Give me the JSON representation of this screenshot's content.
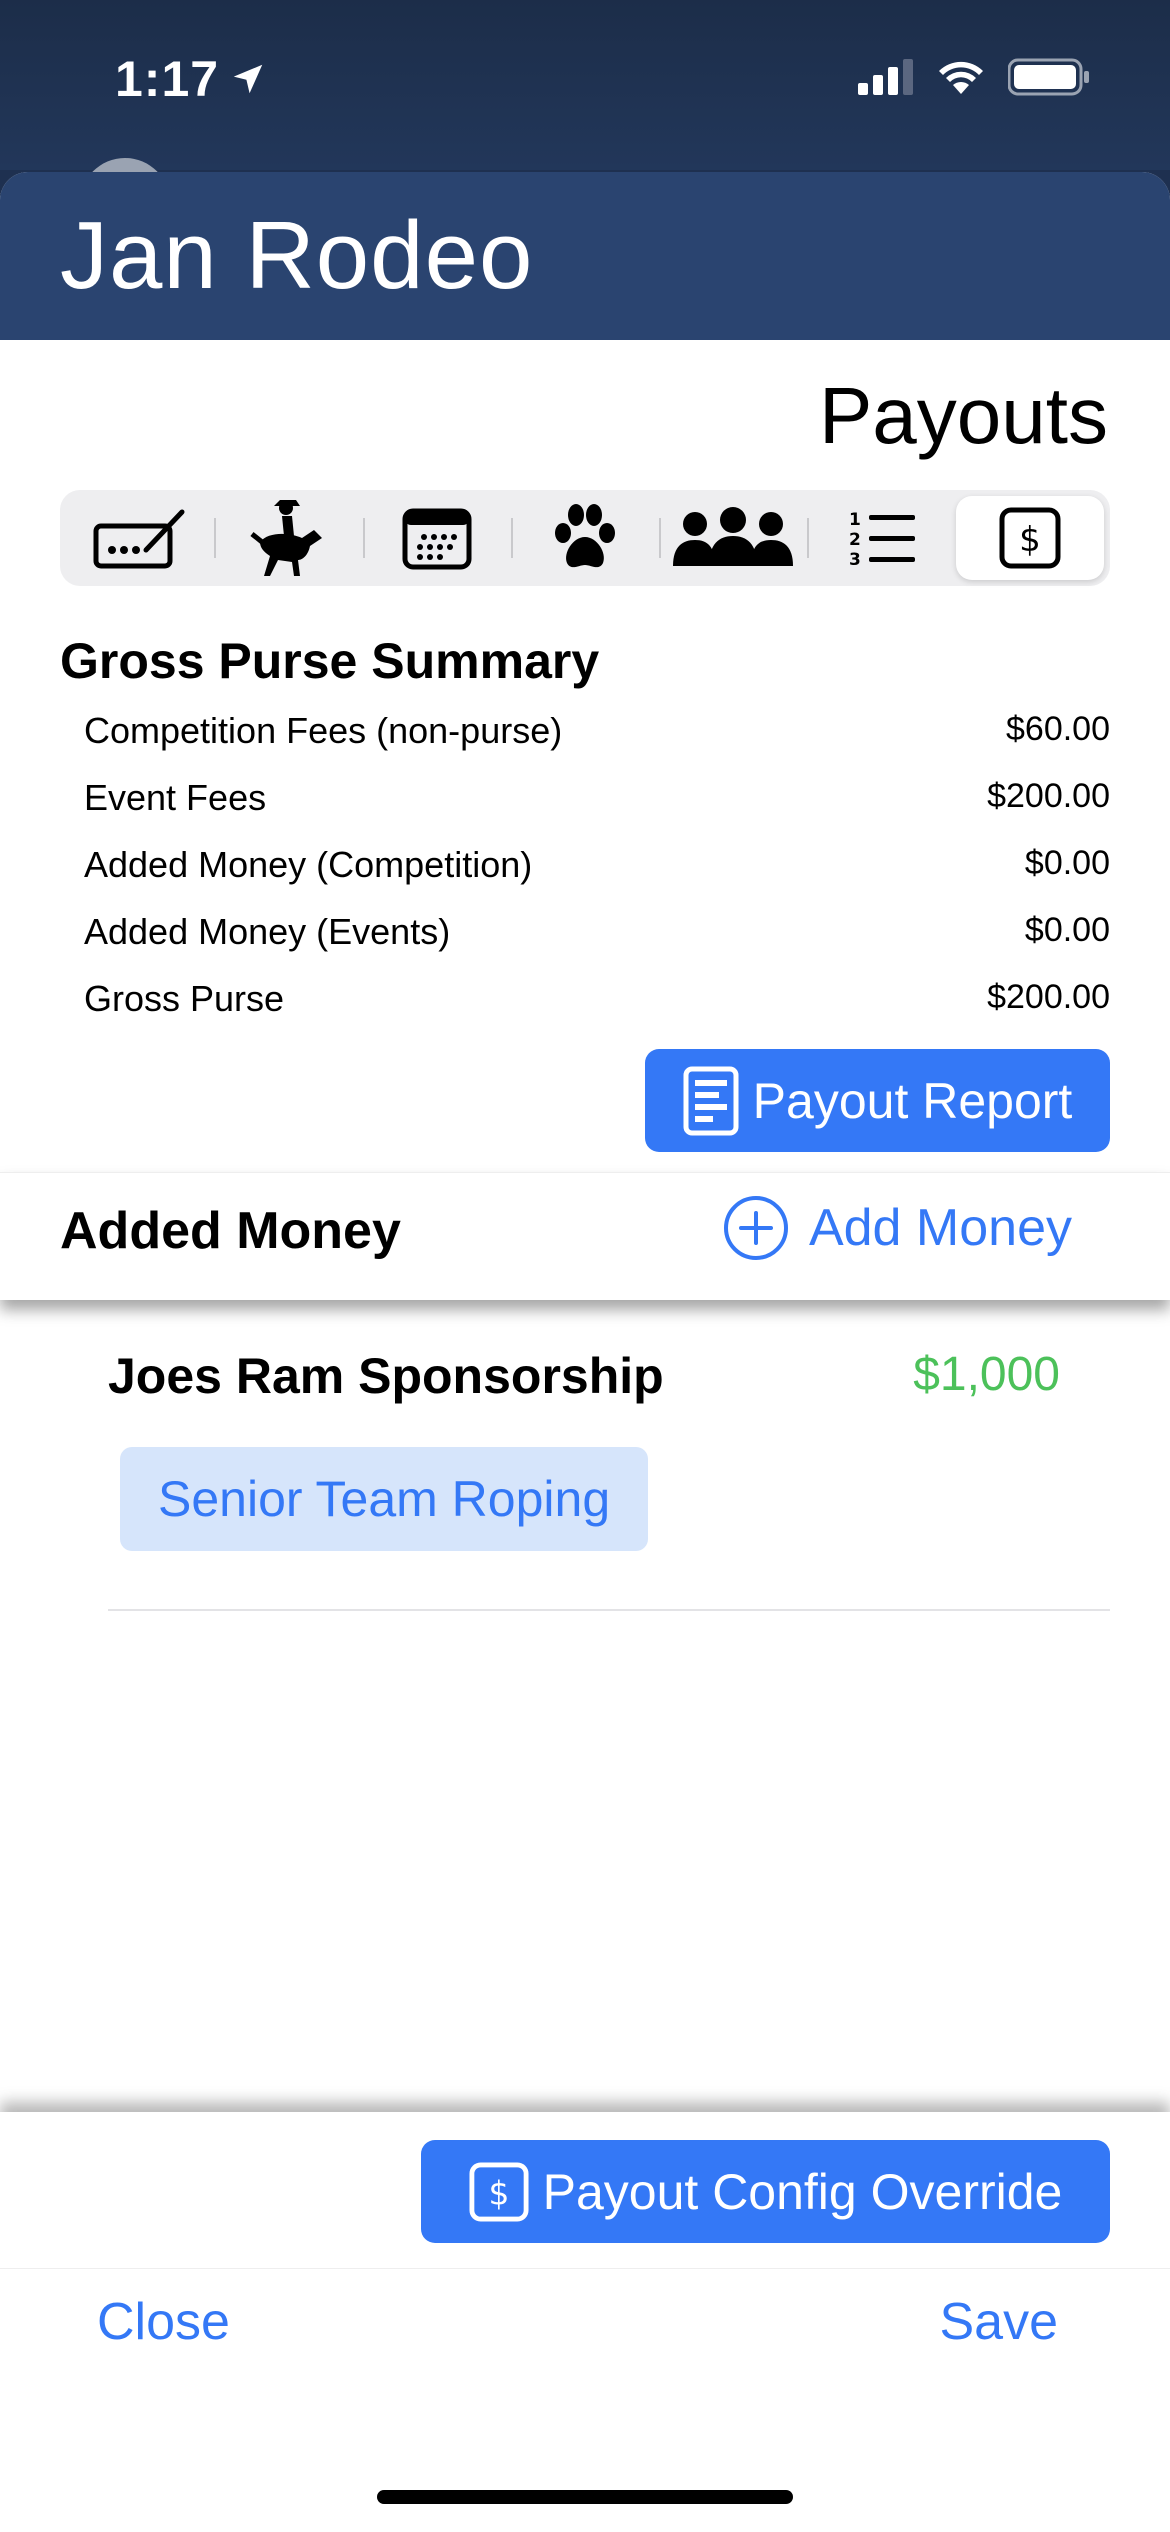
{
  "status_bar": {
    "time": "1:17"
  },
  "header": {
    "title": "Jan Rodeo"
  },
  "page_heading": "Payouts",
  "tabs": [
    {
      "icon": "entry-ticket-icon",
      "active": false
    },
    {
      "icon": "bronc-rider-icon",
      "active": false
    },
    {
      "icon": "calendar-icon",
      "active": false
    },
    {
      "icon": "paw-icon",
      "active": false
    },
    {
      "icon": "people-group-icon",
      "active": false
    },
    {
      "icon": "numbered-list-icon",
      "active": false
    },
    {
      "icon": "dollar-icon",
      "active": true
    }
  ],
  "gross_purse": {
    "heading": "Gross Purse Summary",
    "rows": [
      {
        "label": "Competition Fees (non-purse)",
        "value": "$60.00"
      },
      {
        "label": "Event Fees",
        "value": "$200.00"
      },
      {
        "label": "Added Money (Competition)",
        "value": "$0.00"
      },
      {
        "label": "Added Money (Events)",
        "value": "$0.00"
      },
      {
        "label": "Gross Purse",
        "value": "$200.00"
      }
    ],
    "report_button": "Payout Report"
  },
  "added_money": {
    "label": "Added Money",
    "add_button": "Add Money",
    "items": [
      {
        "name": "Joes Ram Sponsorship",
        "amount": "$1,000",
        "event": "Senior Team Roping"
      }
    ]
  },
  "override_button": "Payout Config Override",
  "footer": {
    "close": "Close",
    "save": "Save"
  },
  "colors": {
    "accent": "#3478f6",
    "header": "#2a4470",
    "money_green": "#4cc15a"
  }
}
